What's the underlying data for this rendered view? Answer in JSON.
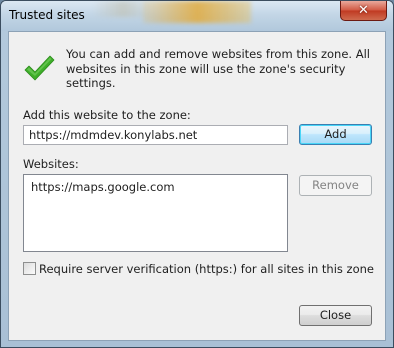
{
  "window": {
    "title": "Trusted sites",
    "close_glyph": "✕"
  },
  "info": {
    "icon": "green-check-icon",
    "text": "You can add and remove websites from this zone. All websites in this zone will use the zone's security settings."
  },
  "add_section": {
    "label": "Add this website to the zone:",
    "input_value": "https://mdmdev.konylabs.net",
    "add_button": "Add"
  },
  "websites_section": {
    "label": "Websites:",
    "items": [
      "https://maps.google.com"
    ],
    "remove_button": "Remove"
  },
  "verification": {
    "label": "Require server verification (https:) for all sites in this zone",
    "checked": false
  },
  "footer": {
    "close_button": "Close"
  },
  "colors": {
    "check_green": "#3fae2a",
    "close_red": "#c8432b",
    "accent_blue": "#3c7fb1"
  }
}
